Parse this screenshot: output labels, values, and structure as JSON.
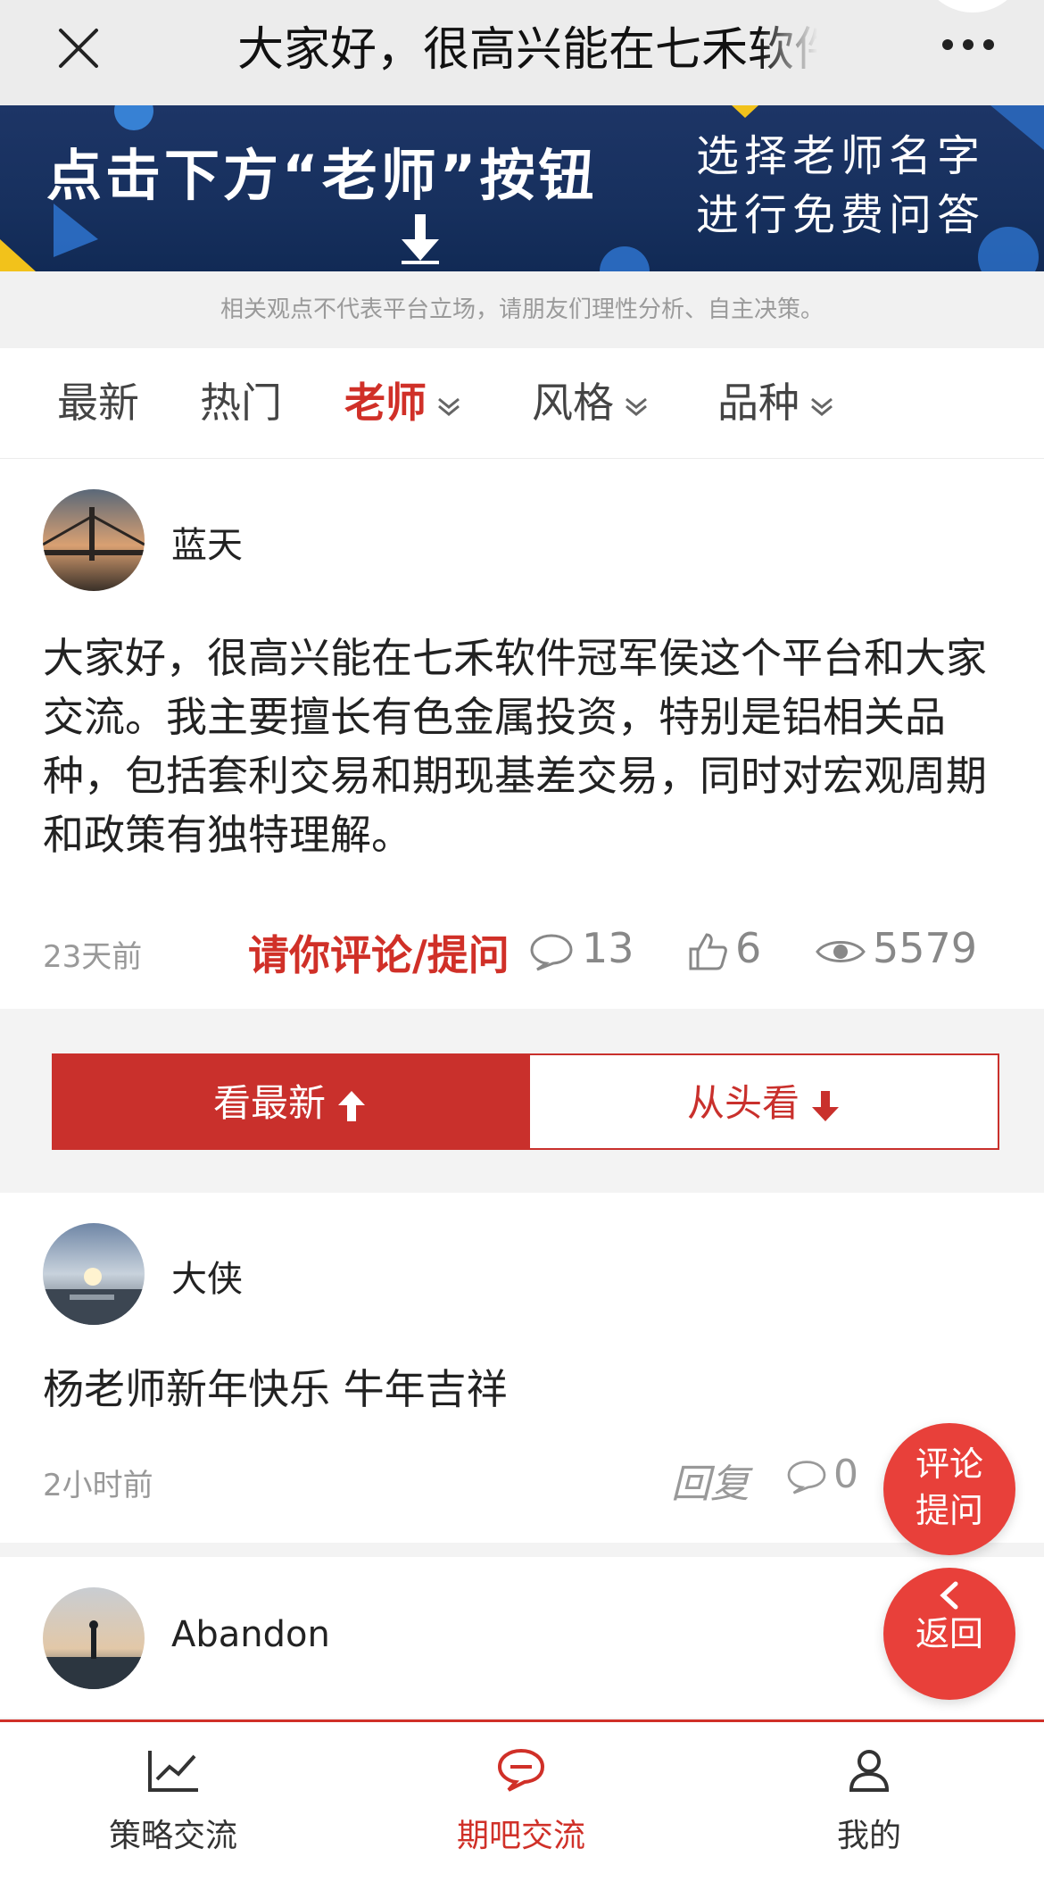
{
  "header": {
    "title": "大家好，很高兴能在七禾软件冠军侯这个平台和大家交流。",
    "close_icon": "close-icon",
    "more_icon": "more-icon"
  },
  "banner": {
    "left_text": "点击下方“老师”按钮",
    "right_line1": "选择老师名字",
    "right_line2": "进行免费问答"
  },
  "disclaimer": "相关观点不代表平台立场，请朋友们理性分析、自主决策。",
  "tabs": [
    {
      "label": "最新",
      "active": false,
      "dropdown": false
    },
    {
      "label": "热门",
      "active": false,
      "dropdown": false
    },
    {
      "label": "老师",
      "active": true,
      "dropdown": true
    },
    {
      "label": "风格",
      "active": false,
      "dropdown": true
    },
    {
      "label": "品种",
      "active": false,
      "dropdown": true
    }
  ],
  "post": {
    "author": "蓝天",
    "content": "大家好，很高兴能在七禾软件冠军侯这个平台和大家交流。我主要擅长有色金属投资，特别是铝相关品种，包括套利交易和期现基差交易，同时对宏观周期和政策有独特理解。",
    "time": "23天前",
    "ask_label": "请你评论/提问",
    "comments": "13",
    "likes": "6",
    "views": "5579"
  },
  "order": {
    "latest_label": "看最新",
    "oldest_label": "从头看"
  },
  "comments": [
    {
      "author": "大侠",
      "text": "杨老师新年快乐 牛年吉祥",
      "time": "2小时前",
      "reply_label": "回复",
      "count": "0"
    },
    {
      "author": "Abandon"
    }
  ],
  "fab": {
    "comment_line1": "评论",
    "comment_line2": "提问",
    "back_label": "返回"
  },
  "bottom_nav": [
    {
      "label": "策略交流",
      "icon": "chart-icon",
      "active": false
    },
    {
      "label": "期吧交流",
      "icon": "chat-bubble-icon",
      "active": true
    },
    {
      "label": "我的",
      "icon": "user-icon",
      "active": false
    }
  ],
  "colors": {
    "accent": "#d03028",
    "banner_bg": "#17305e",
    "fab": "#e8403a"
  }
}
